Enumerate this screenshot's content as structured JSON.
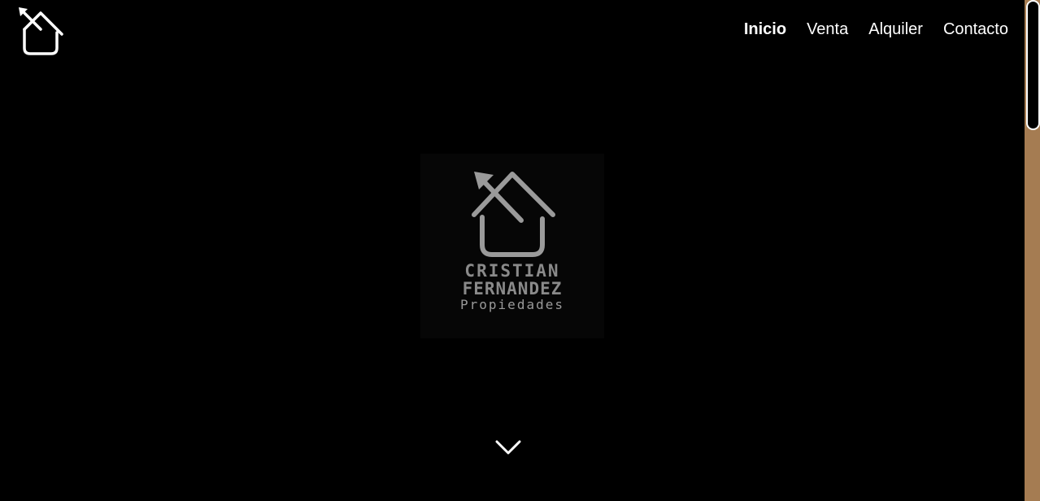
{
  "header": {
    "logo_icon": "house-arrow-logo-icon"
  },
  "nav": {
    "items": [
      {
        "label": "Inicio",
        "active": true
      },
      {
        "label": "Venta",
        "active": false
      },
      {
        "label": "Alquiler",
        "active": false
      },
      {
        "label": "Contacto",
        "active": false
      }
    ]
  },
  "hero": {
    "logo_icon": "house-arrow-logo-icon",
    "line1": "CRISTIAN",
    "line2": "FERNANDEZ",
    "line3": "Propiedades",
    "scroll_icon": "chevron-down-icon"
  },
  "colors": {
    "background": "#000000",
    "nav_text": "#ffffff",
    "logo_gray": "#9a9a9a",
    "scrollbar_track": "#a57c52"
  }
}
